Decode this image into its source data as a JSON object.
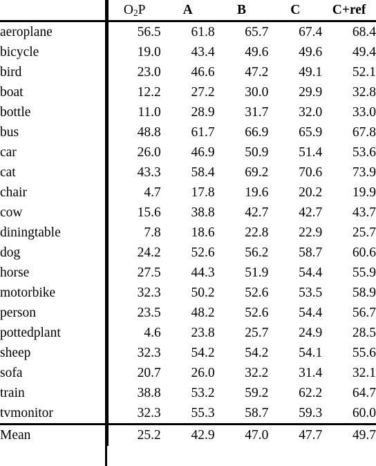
{
  "table": {
    "name": "per-class-segmentation-results",
    "columns": [
      {
        "id": "class",
        "label": "",
        "bold": false,
        "align": "left"
      },
      {
        "id": "o2p",
        "label": "O2P",
        "bold": false,
        "align": "right"
      },
      {
        "id": "a",
        "label": "A",
        "bold": true,
        "align": "right"
      },
      {
        "id": "b",
        "label": "B",
        "bold": true,
        "align": "right"
      },
      {
        "id": "c",
        "label": "C",
        "bold": true,
        "align": "right"
      },
      {
        "id": "cref",
        "label": "C+ref",
        "bold": true,
        "align": "right"
      }
    ],
    "header_o2p_prefix": "O",
    "header_o2p_sub": "2",
    "header_o2p_suffix": "P",
    "rows": [
      {
        "label": "aeroplane",
        "values": [
          "56.5",
          "61.8",
          "65.7",
          "67.4",
          "68.4"
        ],
        "bold": [
          false,
          false,
          false,
          false,
          true
        ]
      },
      {
        "label": "bicycle",
        "values": [
          "19.0",
          "43.4",
          "49.6",
          "49.6",
          "49.4"
        ],
        "bold": [
          false,
          false,
          true,
          true,
          false
        ]
      },
      {
        "label": "bird",
        "values": [
          "23.0",
          "46.6",
          "47.2",
          "49.1",
          "52.1"
        ],
        "bold": [
          false,
          false,
          false,
          false,
          true
        ]
      },
      {
        "label": "boat",
        "values": [
          "12.2",
          "27.2",
          "30.0",
          "29.9",
          "32.8"
        ],
        "bold": [
          false,
          false,
          false,
          false,
          true
        ]
      },
      {
        "label": "bottle",
        "values": [
          "11.0",
          "28.9",
          "31.7",
          "32.0",
          "33.0"
        ],
        "bold": [
          false,
          false,
          false,
          false,
          true
        ]
      },
      {
        "label": "bus",
        "values": [
          "48.8",
          "61.7",
          "66.9",
          "65.9",
          "67.8"
        ],
        "bold": [
          false,
          false,
          false,
          false,
          true
        ]
      },
      {
        "label": "car",
        "values": [
          "26.0",
          "46.9",
          "50.9",
          "51.4",
          "53.6"
        ],
        "bold": [
          false,
          false,
          false,
          false,
          true
        ]
      },
      {
        "label": "cat",
        "values": [
          "43.3",
          "58.4",
          "69.2",
          "70.6",
          "73.9"
        ],
        "bold": [
          false,
          false,
          false,
          false,
          true
        ]
      },
      {
        "label": "chair",
        "values": [
          "4.7",
          "17.8",
          "19.6",
          "20.2",
          "19.9"
        ],
        "bold": [
          false,
          false,
          false,
          true,
          false
        ]
      },
      {
        "label": "cow",
        "values": [
          "15.6",
          "38.8",
          "42.7",
          "42.7",
          "43.7"
        ],
        "bold": [
          false,
          false,
          false,
          false,
          true
        ]
      },
      {
        "label": "diningtable",
        "values": [
          "7.8",
          "18.6",
          "22.8",
          "22.9",
          "25.7"
        ],
        "bold": [
          false,
          false,
          false,
          false,
          true
        ]
      },
      {
        "label": "dog",
        "values": [
          "24.2",
          "52.6",
          "56.2",
          "58.7",
          "60.6"
        ],
        "bold": [
          false,
          false,
          false,
          false,
          true
        ]
      },
      {
        "label": "horse",
        "values": [
          "27.5",
          "44.3",
          "51.9",
          "54.4",
          "55.9"
        ],
        "bold": [
          false,
          false,
          false,
          false,
          true
        ]
      },
      {
        "label": "motorbike",
        "values": [
          "32.3",
          "50.2",
          "52.6",
          "53.5",
          "58.9"
        ],
        "bold": [
          false,
          false,
          false,
          false,
          true
        ]
      },
      {
        "label": "person",
        "values": [
          "23.5",
          "48.2",
          "52.6",
          "54.4",
          "56.7"
        ],
        "bold": [
          false,
          false,
          false,
          false,
          true
        ]
      },
      {
        "label": "pottedplant",
        "values": [
          "4.6",
          "23.8",
          "25.7",
          "24.9",
          "28.5"
        ],
        "bold": [
          false,
          false,
          false,
          false,
          true
        ]
      },
      {
        "label": "sheep",
        "values": [
          "32.3",
          "54.2",
          "54.2",
          "54.1",
          "55.6"
        ],
        "bold": [
          false,
          false,
          false,
          false,
          true
        ]
      },
      {
        "label": "sofa",
        "values": [
          "20.7",
          "26.0",
          "32.2",
          "31.4",
          "32.1"
        ],
        "bold": [
          false,
          false,
          true,
          false,
          false
        ]
      },
      {
        "label": "train",
        "values": [
          "38.8",
          "53.2",
          "59.2",
          "62.2",
          "64.7"
        ],
        "bold": [
          false,
          false,
          false,
          false,
          true
        ]
      },
      {
        "label": "tvmonitor",
        "values": [
          "32.3",
          "55.3",
          "58.7",
          "59.3",
          "60.0"
        ],
        "bold": [
          false,
          false,
          false,
          false,
          true
        ]
      }
    ],
    "summary": {
      "label": "Mean",
      "values": [
        "25.2",
        "42.9",
        "47.0",
        "47.7",
        "49.7"
      ],
      "bold": [
        false,
        false,
        false,
        false,
        true
      ]
    }
  }
}
